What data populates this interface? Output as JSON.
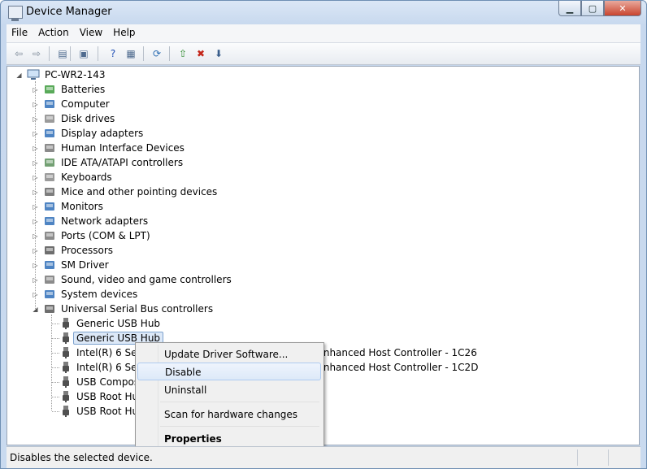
{
  "window": {
    "title": "Device Manager"
  },
  "menu": [
    "File",
    "Action",
    "View",
    "Help"
  ],
  "toolbar": [
    {
      "name": "back-arrow-icon",
      "glyph": "⇦",
      "color": "#7a8796"
    },
    {
      "name": "forward-arrow-icon",
      "glyph": "⇨",
      "color": "#7a8796"
    },
    {
      "name": "show-hide-tree-icon",
      "glyph": "▤",
      "color": "#4f6b8f"
    },
    {
      "name": "properties-icon",
      "glyph": "▣",
      "color": "#4f6b8f"
    },
    {
      "name": "help-icon",
      "glyph": "?",
      "color": "#1f4fb5"
    },
    {
      "name": "view-icon",
      "glyph": "▦",
      "color": "#4f6b8f"
    },
    {
      "name": "scan-hardware-icon",
      "glyph": "⟳",
      "color": "#2c6db3"
    },
    {
      "name": "update-driver-icon",
      "glyph": "⇧",
      "color": "#2f8a2f"
    },
    {
      "name": "uninstall-icon",
      "glyph": "✖",
      "color": "#c4271b"
    },
    {
      "name": "disable-device-icon",
      "glyph": "⬇",
      "color": "#3a5e8c"
    }
  ],
  "tree": {
    "root": "PC-WR2-143",
    "categories": [
      {
        "label": "Batteries",
        "icon": "battery-icon",
        "color": "#3c9b3c"
      },
      {
        "label": "Computer",
        "icon": "computer-icon",
        "color": "#2f6fb8"
      },
      {
        "label": "Disk drives",
        "icon": "disk-drive-icon",
        "color": "#8a8a8a"
      },
      {
        "label": "Display adapters",
        "icon": "display-adapter-icon",
        "color": "#2f6fb8"
      },
      {
        "label": "Human Interface Devices",
        "icon": "hid-icon",
        "color": "#777777"
      },
      {
        "label": "IDE ATA/ATAPI controllers",
        "icon": "ide-controller-icon",
        "color": "#5a8f5a"
      },
      {
        "label": "Keyboards",
        "icon": "keyboard-icon",
        "color": "#8a8a8a"
      },
      {
        "label": "Mice and other pointing devices",
        "icon": "mouse-icon",
        "color": "#666666"
      },
      {
        "label": "Monitors",
        "icon": "monitor-icon",
        "color": "#2f6fb8"
      },
      {
        "label": "Network adapters",
        "icon": "network-adapter-icon",
        "color": "#2f6fb8"
      },
      {
        "label": "Ports (COM & LPT)",
        "icon": "port-icon",
        "color": "#777777"
      },
      {
        "label": "Processors",
        "icon": "processor-icon",
        "color": "#555555"
      },
      {
        "label": "SM Driver",
        "icon": "sm-driver-icon",
        "color": "#2f6fb8"
      },
      {
        "label": "Sound, video and game controllers",
        "icon": "speaker-icon",
        "color": "#777777"
      },
      {
        "label": "System devices",
        "icon": "system-devices-icon",
        "color": "#2f6fb8"
      },
      {
        "label": "Universal Serial Bus controllers",
        "icon": "usb-icon",
        "color": "#555555"
      }
    ],
    "usb_children": [
      "Generic USB Hub",
      "Generic USB Hub",
      "Intel(R) 6 Series/C200 Series Chipset Family USB Enhanced Host Controller - 1C26",
      "Intel(R) 6 Series/C200 Series Chipset Family USB Enhanced Host Controller - 1C2D",
      "USB Composite Device",
      "USB Root Hub",
      "USB Root Hub"
    ]
  },
  "context_menu": {
    "items": [
      "Update Driver Software...",
      "Disable",
      "Uninstall",
      "Scan for hardware changes",
      "Properties"
    ],
    "hovered": "Disable",
    "default": "Properties"
  },
  "status": {
    "text": "Disables the selected device."
  }
}
